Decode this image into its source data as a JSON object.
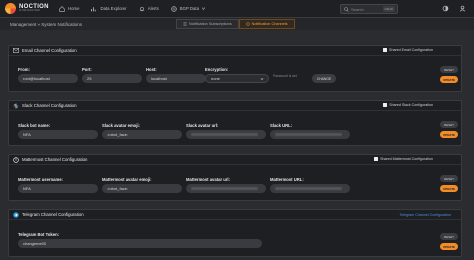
{
  "brand": {
    "name": "NOCTION",
    "tagline": "FLOW ANALYZER"
  },
  "nav": [
    {
      "label": "Home",
      "icon": "home-icon"
    },
    {
      "label": "Data Explorer",
      "icon": "chart-icon"
    },
    {
      "label": "Alerts",
      "icon": "bell-icon"
    },
    {
      "label": "BGP Data",
      "icon": "globe-icon"
    }
  ],
  "search": {
    "placeholder": "Search",
    "shortcut": "Ctrl+K"
  },
  "breadcrumb": "Management » System Notifications",
  "tabs": [
    {
      "label": "Notification Subscriptions",
      "active": false
    },
    {
      "label": "Notification Channels",
      "active": true
    }
  ],
  "common": {
    "reset": "RESET",
    "update": "UPDATE",
    "change": "CHANGE"
  },
  "email": {
    "title": "Email Channel Configuration",
    "share": "Shared Email Configuration",
    "from_label": "From:",
    "from_value": "root@localhost",
    "port_label": "Port:",
    "port_value": "25",
    "host_label": "Host:",
    "host_value": "localhost",
    "enc_label": "Encryption:",
    "enc_value": "none",
    "password_label": "Password is set"
  },
  "slack": {
    "title": "Slack Channel Configuration",
    "share": "Shared Slack Configuration",
    "bot_label": "Slack bot name:",
    "bot_value": "NFA",
    "emoji_label": "Slack avatar emoji:",
    "emoji_value": ":robot_face:",
    "url_label": "Slack avatar url:",
    "slackurl_label": "Slack URL:"
  },
  "mattermost": {
    "title": "Mattermost Channel Configuration",
    "share": "Shared Mattermost Configuration",
    "user_label": "Mattermost username:",
    "user_value": "NFA",
    "emoji_label": "Mattermost avatar emoji:",
    "emoji_value": ":robot_face:",
    "url_label": "Mattermost avatar url:",
    "mmurl_label": "Mattermost URL:"
  },
  "telegram": {
    "title": "Telegram Channel Configuration",
    "share_link": "Telegram Channel Configuration",
    "token_label": "Telegram Bot Token:",
    "token_value": "changeme00"
  },
  "colors": {
    "accent": "#f28c28",
    "link": "#4a90e2",
    "panel": "#1e1f22"
  }
}
